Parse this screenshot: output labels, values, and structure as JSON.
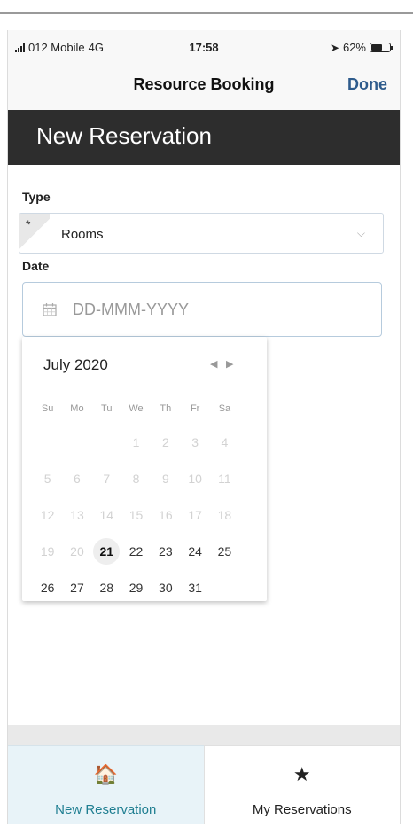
{
  "status_bar": {
    "carrier": "012 Mobile",
    "network": "4G",
    "time": "17:58",
    "battery": "62%",
    "battery_level": 0.62
  },
  "nav": {
    "title": "Resource Booking",
    "done_label": "Done"
  },
  "header": {
    "title": "New Reservation"
  },
  "form": {
    "type_label": "Type",
    "type_required_marker": "*",
    "type_value": "Rooms",
    "date_label": "Date",
    "date_placeholder": "DD-MMM-YYYY"
  },
  "calendar": {
    "month_label": "July 2020",
    "prev_icon": "◀",
    "next_icon": "▶",
    "weekdays": [
      "Su",
      "Mo",
      "Tu",
      "We",
      "Th",
      "Fr",
      "Sa"
    ],
    "selected_day": "21",
    "weeks": [
      [
        {
          "d": "",
          "s": "blank"
        },
        {
          "d": "",
          "s": "blank"
        },
        {
          "d": "",
          "s": "blank"
        },
        {
          "d": "1",
          "s": "disabled"
        },
        {
          "d": "2",
          "s": "disabled"
        },
        {
          "d": "3",
          "s": "disabled"
        },
        {
          "d": "4",
          "s": "disabled"
        }
      ],
      [
        {
          "d": "5",
          "s": "disabled"
        },
        {
          "d": "6",
          "s": "disabled"
        },
        {
          "d": "7",
          "s": "disabled"
        },
        {
          "d": "8",
          "s": "disabled"
        },
        {
          "d": "9",
          "s": "disabled"
        },
        {
          "d": "10",
          "s": "disabled"
        },
        {
          "d": "11",
          "s": "disabled"
        }
      ],
      [
        {
          "d": "12",
          "s": "disabled"
        },
        {
          "d": "13",
          "s": "disabled"
        },
        {
          "d": "14",
          "s": "disabled"
        },
        {
          "d": "15",
          "s": "disabled"
        },
        {
          "d": "16",
          "s": "disabled"
        },
        {
          "d": "17",
          "s": "disabled"
        },
        {
          "d": "18",
          "s": "disabled"
        }
      ],
      [
        {
          "d": "19",
          "s": "disabled"
        },
        {
          "d": "20",
          "s": "disabled"
        },
        {
          "d": "21",
          "s": "today"
        },
        {
          "d": "22",
          "s": "enabled"
        },
        {
          "d": "23",
          "s": "enabled"
        },
        {
          "d": "24",
          "s": "enabled"
        },
        {
          "d": "25",
          "s": "enabled"
        }
      ],
      [
        {
          "d": "26",
          "s": "enabled"
        },
        {
          "d": "27",
          "s": "enabled"
        },
        {
          "d": "28",
          "s": "enabled"
        },
        {
          "d": "29",
          "s": "enabled"
        },
        {
          "d": "30",
          "s": "enabled"
        },
        {
          "d": "31",
          "s": "enabled"
        },
        {
          "d": "",
          "s": "blank"
        }
      ]
    ]
  },
  "tabs": [
    {
      "label": "New Reservation",
      "icon": "home-icon",
      "glyph": "🏠",
      "active": true
    },
    {
      "label": "My Reservations",
      "icon": "star-icon",
      "glyph": "★",
      "active": false
    }
  ],
  "colors": {
    "header_bg": "#2d2d2d",
    "accent_blue": "#2e5b8c",
    "active_tab": "#1f7e91",
    "active_tab_bg": "#e8f3f8"
  }
}
